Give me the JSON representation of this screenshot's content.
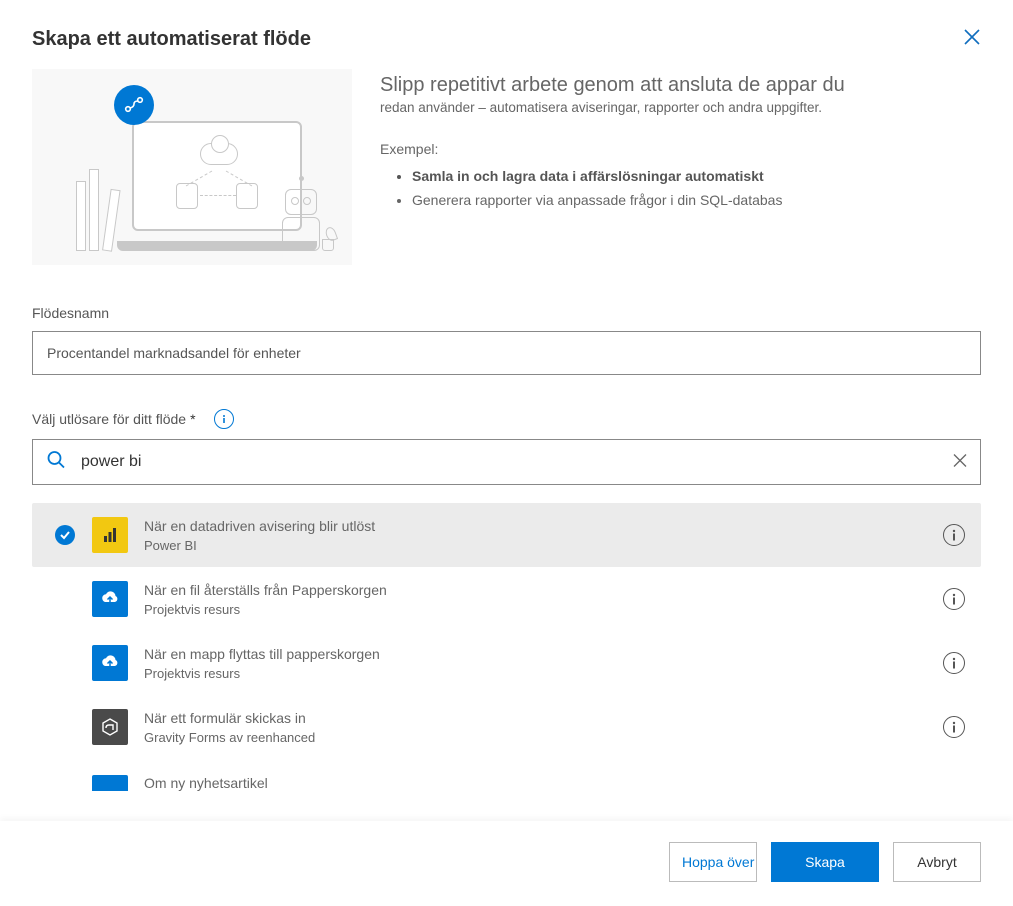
{
  "dialog": {
    "title": "Skapa ett automatiserat flöde"
  },
  "hero": {
    "heading": "Slipp repetitivt arbete genom att ansluta de appar du",
    "subheading": "redan använder – automatisera aviseringar, rapporter och andra uppgifter.",
    "examples_label": "Exempel:",
    "example_bold": "Samla in och lagra data i affärslösningar automatiskt",
    "example_plain": "Generera rapporter via anpassade frågor i din SQL-databas"
  },
  "flow_name": {
    "label": "Flödesnamn",
    "value": "Procentandel marknadsandel för enheter"
  },
  "trigger_section": {
    "label": "Välj utlösare för ditt flöde",
    "required_mark": "*",
    "search_value": "power bi"
  },
  "icons": {
    "info": "i",
    "close": "✕",
    "clear": "✕",
    "check": "✓"
  },
  "triggers": [
    {
      "title": "När en datadriven avisering blir utlöst",
      "connector": "Power BI",
      "icon": "powerbi",
      "selected": true
    },
    {
      "title": "När en fil återställs från Papperskorgen",
      "connector": "Projektvis resurs",
      "icon": "project",
      "selected": false
    },
    {
      "title": "När en mapp flyttas till papperskorgen",
      "connector": "Projektvis resurs",
      "icon": "project",
      "selected": false
    },
    {
      "title": "När ett formulär skickas in",
      "connector": "Gravity Forms av reenhanced",
      "icon": "gravity",
      "selected": false
    },
    {
      "title": "Om ny nyhetsartikel",
      "connector": "",
      "icon": "inoreader",
      "selected": false
    }
  ],
  "footer": {
    "skip": "Hoppa över",
    "create": "Skapa",
    "cancel": "Avbryt"
  }
}
